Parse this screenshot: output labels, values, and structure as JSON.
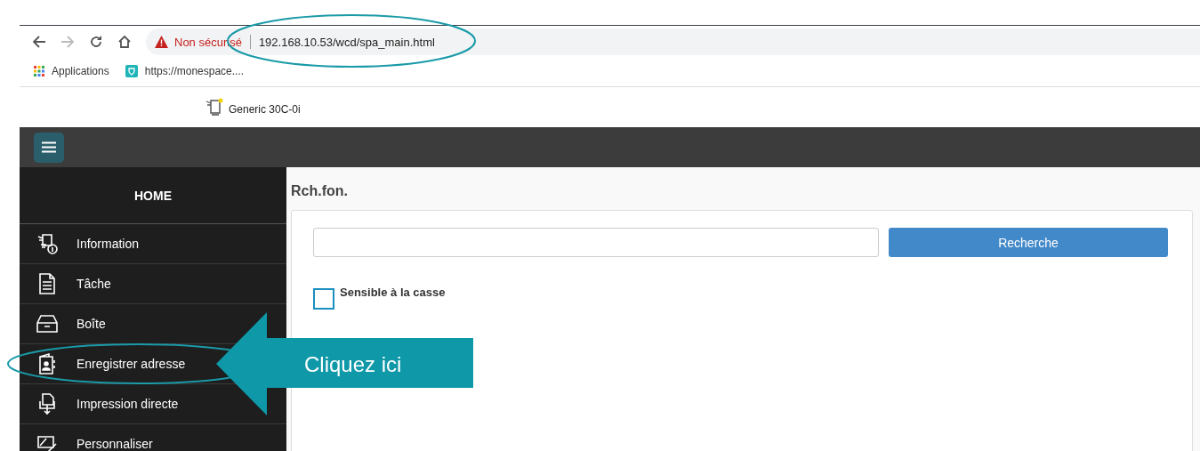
{
  "browser": {
    "security_label": "Non sécurisé",
    "url": "192.168.10.53/wcd/spa_main.html",
    "bookmarks": [
      {
        "kind": "apps",
        "label": "Applications"
      },
      {
        "kind": "site",
        "label": "https://monespace...."
      }
    ]
  },
  "device": {
    "name": "Generic 30C-0i"
  },
  "sidebar": {
    "header": "HOME",
    "items": [
      {
        "kind": "info",
        "label": "Information"
      },
      {
        "kind": "job",
        "label": "Tâche"
      },
      {
        "kind": "box",
        "label": "Boîte"
      },
      {
        "kind": "address",
        "label": "Enregistrer adresse"
      },
      {
        "kind": "print",
        "label": "Impression directe"
      },
      {
        "kind": "custom",
        "label": "Personnaliser"
      }
    ]
  },
  "main": {
    "title": "Rch.fon.",
    "search_button": "Recherche",
    "case_checkbox": {
      "label": "Sensible à la casse",
      "checked": false
    }
  },
  "annotation": {
    "callout": "Cliquez ici"
  }
}
